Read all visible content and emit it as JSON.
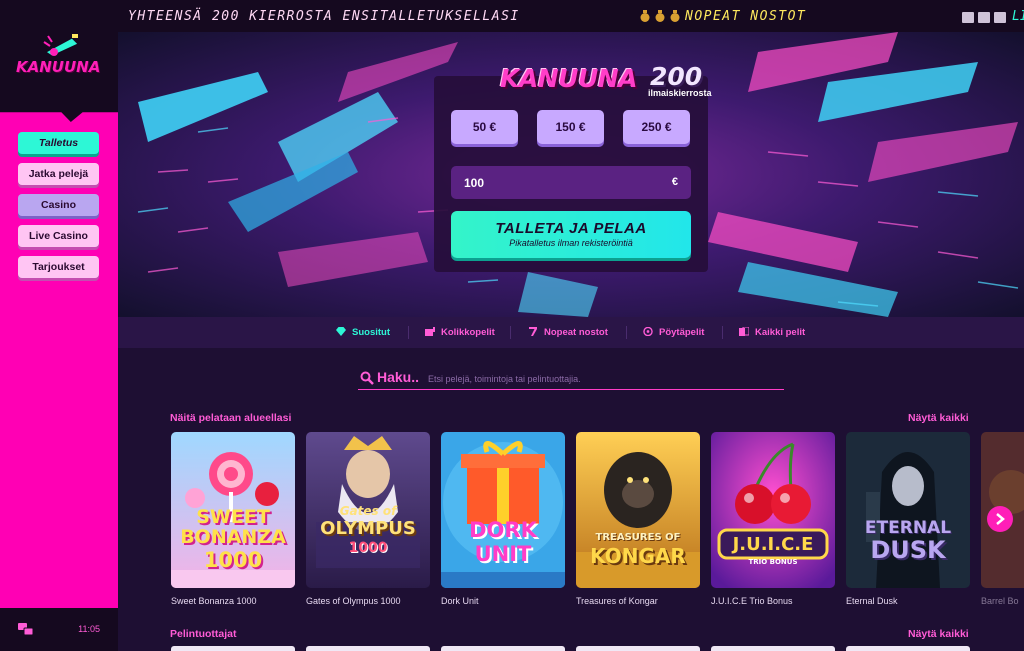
{
  "sidebar": {
    "logo_text": "KANUUNA",
    "nav": [
      {
        "label": "Talletus"
      },
      {
        "label": "Jatka pelejä"
      },
      {
        "label": "Casino"
      },
      {
        "label": "Live Casino"
      },
      {
        "label": "Tarjoukset"
      }
    ],
    "clock": "11:05"
  },
  "ticker": {
    "text": "YHTEENSÄ 200 KIERROSTA ENSITALLETUKSELLASI",
    "right_text": "NOPEAT NOSTOT",
    "end_text": "LI"
  },
  "hero": {
    "brand_name": "KANUUNA",
    "brand_number": "200",
    "brand_sub": "ilmaiskierrosta",
    "amounts": [
      "50 €",
      "150 €",
      "250 €"
    ],
    "input_value": "100",
    "currency": "€",
    "cta_main": "TALLETA JA PELAA",
    "cta_sub": "Pikatalletus ilman rekisteröintiä"
  },
  "categories": [
    {
      "label": "Suositut",
      "icon": "diamond-icon"
    },
    {
      "label": "Kolikkopelit",
      "icon": "slot-machine-icon"
    },
    {
      "label": "Nopeat nostot",
      "icon": "seven-icon"
    },
    {
      "label": "Pöytäpelit",
      "icon": "chip-icon"
    },
    {
      "label": "Kaikki pelit",
      "icon": "cards-icon"
    }
  ],
  "search": {
    "label": "Haku..",
    "placeholder": "Etsi pelejä, toimintoja tai pelintuottajia."
  },
  "popular": {
    "title": "Näitä pelataan alueellasi",
    "see_all": "Näytä kaikki",
    "games": [
      {
        "name": "Sweet Bonanza 1000",
        "art": [
          "SWEET",
          "BONANZA",
          "1000"
        ]
      },
      {
        "name": "Gates of Olympus 1000",
        "art": [
          "Gates of",
          "OLYMPUS",
          "1000"
        ]
      },
      {
        "name": "Dork Unit",
        "art": [
          "DORK",
          "UNIT"
        ]
      },
      {
        "name": "Treasures of Kongar",
        "art": [
          "TREASURES OF",
          "KONGAR"
        ]
      },
      {
        "name": "J.U.I.C.E Trio Bonus",
        "art": [
          "J.U.I.C.E",
          "TRIO BONUS"
        ]
      },
      {
        "name": "Eternal Dusk",
        "art": [
          "ETERNAL",
          "DUSK"
        ]
      },
      {
        "name": "Barrel Bo",
        "art": []
      }
    ]
  },
  "providers": {
    "title": "Pelintuottajat",
    "see_all": "Näytä kaikki"
  },
  "colors": {
    "accent_pink": "#ff1fb8",
    "accent_cyan": "#2df7d6",
    "background": "#1e0f33"
  }
}
